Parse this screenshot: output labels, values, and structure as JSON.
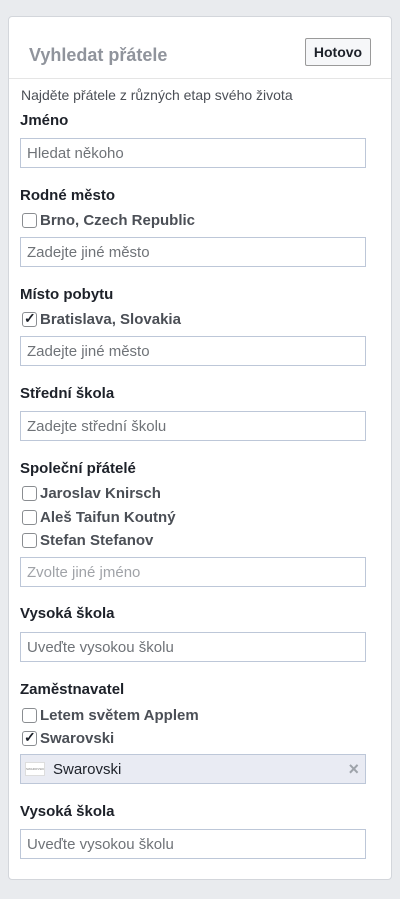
{
  "header": {
    "title": "Vyhledat přátele",
    "done_label": "Hotovo"
  },
  "subtitle": "Najděte přátele z různých etap svého života",
  "name": {
    "label": "Jméno",
    "placeholder": "Hledat někoho"
  },
  "hometown": {
    "label": "Rodné město",
    "options": [
      {
        "label": "Brno, Czech Republic",
        "checked": false
      }
    ],
    "placeholder": "Zadejte jiné město"
  },
  "current_city": {
    "label": "Místo pobytu",
    "options": [
      {
        "label": "Bratislava, Slovakia",
        "checked": true
      }
    ],
    "placeholder": "Zadejte jiné město"
  },
  "high_school": {
    "label": "Střední škola",
    "placeholder": "Zadejte střední školu"
  },
  "mutual_friends": {
    "label": "Společní přátelé",
    "options": [
      {
        "label": "Jaroslav Knirsch",
        "checked": false
      },
      {
        "label": "Aleš Taifun Koutný",
        "checked": false
      },
      {
        "label": "Stefan Stefanov",
        "checked": false
      }
    ],
    "placeholder": "Zvolte jiné jméno"
  },
  "university": {
    "label": "Vysoká škola",
    "placeholder": "Uveďte vysokou školu"
  },
  "employer": {
    "label": "Zaměstnavatel",
    "options": [
      {
        "label": "Letem světem Applem",
        "checked": false
      },
      {
        "label": "Swarovski",
        "checked": true
      }
    ],
    "token": {
      "label": "Swarovski",
      "logo_text": "SWAROVSKI",
      "remove_icon": "×"
    }
  },
  "university2": {
    "label": "Vysoká škola",
    "placeholder": "Uveďte vysokou školu"
  },
  "check_mark": "✓"
}
